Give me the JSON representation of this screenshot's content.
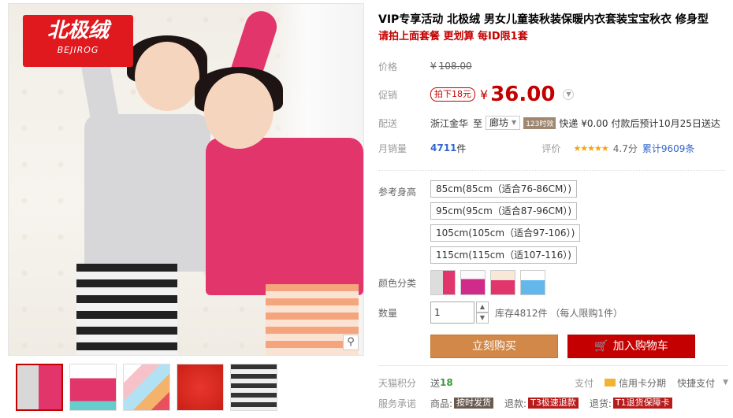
{
  "gallery": {
    "brand_cn": "北极绒",
    "brand_en": "BEJIROG",
    "thumbnail_count": 5
  },
  "product": {
    "title": "VIP专享活动 北极绒 男女儿童装秋装保暖内衣套装宝宝秋衣 修身型",
    "subtitle": "请拍上面套餐 更划算 每ID限1套"
  },
  "price": {
    "label": "价格",
    "currency": "¥",
    "original": "108.00"
  },
  "promo": {
    "label": "促销",
    "tag": "拍下18元",
    "currency": "¥",
    "value": "36.00"
  },
  "delivery": {
    "label": "配送",
    "from": "浙江金华",
    "to_word": "至",
    "destination": "廊坊",
    "badge": "123时效",
    "text": "快递 ¥0.00 付款后预计10月25日送达"
  },
  "sales": {
    "label": "月销量",
    "count": "4711",
    "unit": "件",
    "rating_label": "评价",
    "stars": "★★★★★",
    "score": "4.7分",
    "reviews": "累计9609条"
  },
  "sku": {
    "height_label": "参考身高",
    "heights": [
      "85cm(85cm（适合76-86CM）)",
      "95cm(95cm（适合87-96CM）)",
      "105cm(105cm（适合97-106）)",
      "115cm(115cm（适107-116）)"
    ],
    "color_label": "颜色分类",
    "color_count": 4
  },
  "quantity": {
    "label": "数量",
    "value": "1",
    "up": "▲",
    "down": "▼",
    "stock": "库存4812件  （每人限购1件）"
  },
  "buttons": {
    "buy": "立刻购买",
    "cart": "加入购物车",
    "cart_icon": "🛒"
  },
  "footer": {
    "points_label": "天猫积分",
    "points_text": "送",
    "points_value": "18",
    "pay_label": "支付",
    "credit": "信用卡分期",
    "quick_pay": "快捷支付",
    "service_label": "服务承诺",
    "svc1_label": "商品:",
    "svc1_tag": "按时发货",
    "svc2_label": "退款:",
    "svc2_tag": "T3极速退款",
    "svc3_label": "退货:",
    "svc3_tag": "T1退货保障卡"
  },
  "colors": {
    "accent": "#c40000",
    "buy_button": "#d18848"
  }
}
